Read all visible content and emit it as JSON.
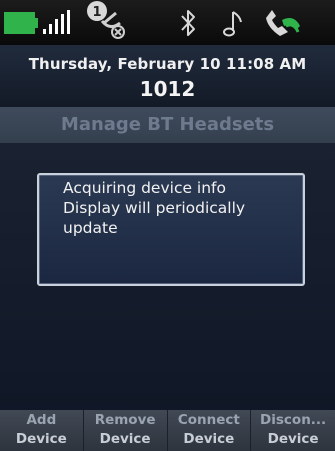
{
  "status_bar": {
    "voicemail_count": "1",
    "icons": [
      "battery-icon",
      "signal-icon",
      "voicemail-icon",
      "bluetooth-icon",
      "music-note-icon",
      "handset-icon"
    ],
    "battery_color": "#2fb34a"
  },
  "header": {
    "date": "Thursday, February 10 11:08 AM",
    "extension": "1012"
  },
  "screen_title": "Manage BT Headsets",
  "message": {
    "line1": "Acquiring device info",
    "line2": "Display will periodically",
    "line3": "update"
  },
  "softkeys": [
    {
      "line1": "Add",
      "line2": "Device"
    },
    {
      "line1": "Remove",
      "line2": "Device"
    },
    {
      "line1": "Connect",
      "line2": "Device"
    },
    {
      "line1": "Discon...",
      "line2": "Device"
    }
  ]
}
